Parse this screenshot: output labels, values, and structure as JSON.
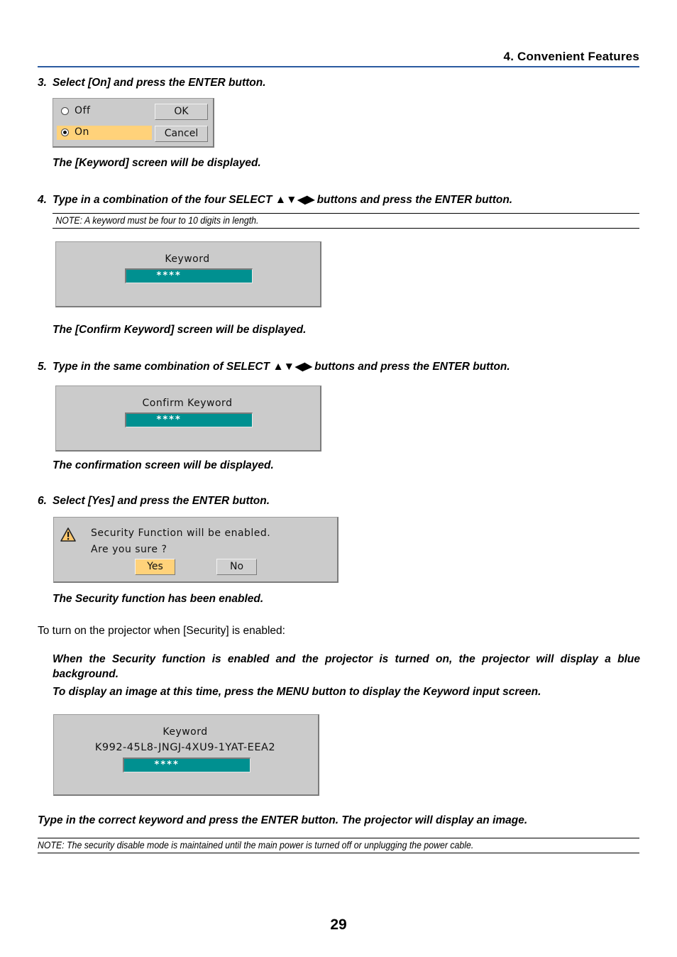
{
  "header": {
    "section_title": "4. Convenient Features",
    "accent_color": "#2a5aa0"
  },
  "steps": [
    {
      "number": "3.",
      "text": "Select [On] and press the ENTER button.",
      "result": "The [Keyword] screen will be displayed."
    },
    {
      "number": "4.",
      "text": "Type in a combination of the four SELECT ▲▼◀▶ buttons and press the ENTER button.",
      "note": "NOTE: A keyword must be four to 10 digits in length.",
      "result": "The [Confirm Keyword] screen will be displayed."
    },
    {
      "number": "5.",
      "text": "Type in the same combination of SELECT ▲▼◀▶ buttons and press the ENTER button.",
      "result": "The confirmation screen will be displayed."
    },
    {
      "number": "6.",
      "text": "Select [Yes] and press the ENTER button.",
      "result": "The Security function has been enabled."
    }
  ],
  "dialogs": {
    "on_off": {
      "options": [
        {
          "label": "Off",
          "selected": false
        },
        {
          "label": "On",
          "selected": true
        }
      ],
      "ok_label": "OK",
      "cancel_label": "Cancel"
    },
    "keyword": {
      "title": "Keyword",
      "value": "****"
    },
    "confirm_keyword": {
      "title": "Confirm Keyword",
      "value": "****"
    },
    "confirm_enable": {
      "icon": "warning-icon",
      "line1": "Security Function will be enabled.",
      "line2": "Are you sure ?",
      "yes_label": "Yes",
      "no_label": "No"
    },
    "keyword_input": {
      "title": "Keyword",
      "request_code": "K992-45L8-JNGJ-4XU9-1YAT-EEA2",
      "value": "****"
    }
  },
  "turn_on_section": {
    "intro": "To turn on the projector when [Security] is enabled:",
    "para1": "When the Security function is enabled and the projector is turned on, the projector will display a blue background.",
    "para2": "To display an image at this time, press the MENU button to display the Keyword input screen.",
    "final": "Type in the correct keyword and press the ENTER button. The projector will display an image.",
    "note": "NOTE: The security disable mode is maintained until the main power is turned off or unplugging the power cable."
  },
  "colors": {
    "osd_bg": "#cbcbcb",
    "highlight": "#ffd27a",
    "field": "#009090"
  },
  "page_number": "29"
}
